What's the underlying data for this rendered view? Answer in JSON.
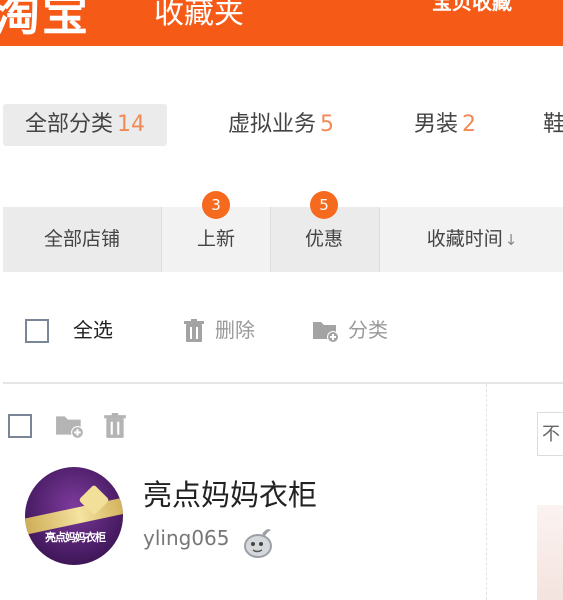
{
  "header": {
    "logo": "淘宝",
    "title": "收藏夹",
    "link": "宝贝收藏"
  },
  "categories": [
    {
      "label": "全部分类",
      "count": "14"
    },
    {
      "label": "虚拟业务",
      "count": "5"
    },
    {
      "label": "男装",
      "count": "2"
    },
    {
      "label": "鞋",
      "count": ""
    }
  ],
  "filters": [
    {
      "label": "全部店铺",
      "badge": ""
    },
    {
      "label": "上新",
      "badge": "3"
    },
    {
      "label": "优惠",
      "badge": "5"
    },
    {
      "label": "收藏时间",
      "badge": "",
      "arrow": "↓"
    }
  ],
  "toolbar": {
    "select_all": "全选",
    "delete": "删除",
    "classify": "分类"
  },
  "item": {
    "shop_name": "亮点妈妈衣柜",
    "username": "yling065",
    "avatar_text": "亮点妈妈衣柜"
  },
  "right_panel": {
    "input_text": "不"
  },
  "icons": {
    "trash": "trash-icon",
    "folder_add": "folder-add-icon",
    "wangwang": "wangwang-icon"
  },
  "colors": {
    "brand": "#f55a17",
    "count": "#f08b58",
    "badge": "#f56a1e"
  }
}
